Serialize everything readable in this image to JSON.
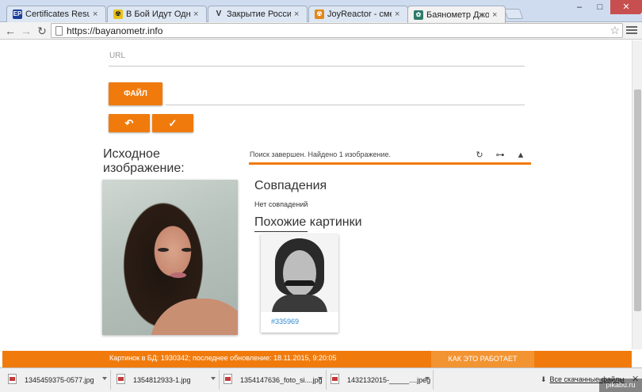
{
  "browser": {
    "tabs": [
      {
        "title": "Certificates Results",
        "icon_text": "EP",
        "icon_color": "#1a3e9c",
        "active": false
      },
      {
        "title": "В Бой Идут Одни Стари",
        "icon_text": "☢",
        "icon_color": "#222222",
        "active": false
      },
      {
        "title": "Закрытие России - почем",
        "icon_text": "V",
        "icon_color": "#ffffff",
        "active": false
      },
      {
        "title": "JoyReactor - смешные ка",
        "icon_text": "☢",
        "icon_color": "#e2871b",
        "active": false
      },
      {
        "title": "Баянометр Джойреактор",
        "icon_text": "✿",
        "icon_color": "#2c7a6a",
        "active": true
      }
    ],
    "tab_close": "×",
    "window_controls": {
      "minimize": "–",
      "maximize": "□",
      "close": "✕"
    },
    "nav": {
      "back": "←",
      "forward": "→",
      "reload": "↻"
    },
    "address": "https://bayanometr.info",
    "star": "☆"
  },
  "form": {
    "url_label": "URL",
    "file_button": "ФАЙЛ",
    "undo_symbol": "↶",
    "check_symbol": "✓"
  },
  "source": {
    "title": "Исходное изображение:"
  },
  "results": {
    "status": "Поиск завершен. Найдено 1 изображение.",
    "status_icons": {
      "refresh": "↻",
      "link": "⊶",
      "warning": "▲"
    },
    "matches_title": "Совпадения",
    "no_matches": "Нет совпадений",
    "similar_title": "Похожие картинки",
    "similar": [
      {
        "id": "#335969"
      }
    ]
  },
  "footer": {
    "info": "Картинок в БД: 1930342; последнее обновление: 18.11.2015, 9:20:05",
    "how_it_works": "КАК ЭТО РАБОТАЕТ",
    "accent": "#f07b0c"
  },
  "downloads": {
    "items": [
      {
        "name": "1345459375-0577.jpg"
      },
      {
        "name": "1354812933-1.jpg"
      },
      {
        "name": "1354147636_foto_si....jpg"
      },
      {
        "name": "1432132015-_____....jpeg"
      }
    ],
    "all_downloads": "Все скачанные файлы",
    "arrow": "⬇",
    "close": "✕"
  },
  "watermark": "pikabu.ru"
}
